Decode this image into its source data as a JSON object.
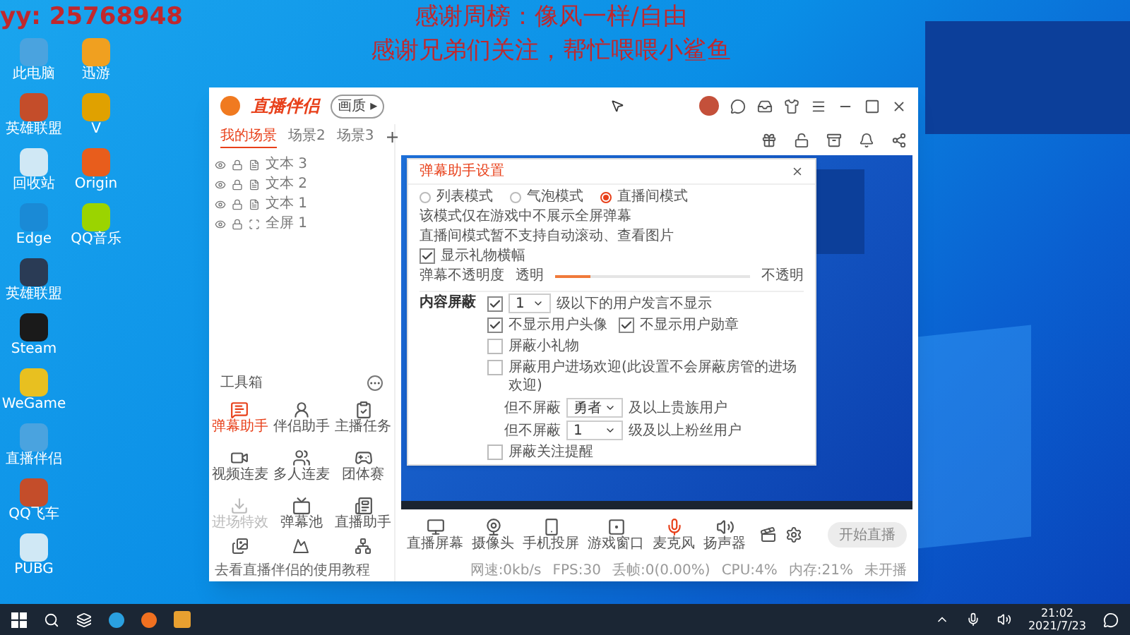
{
  "overlay": {
    "room_text": "yy: 25768948",
    "lines": [
      "感谢周榜：像风一样/自由",
      "感谢兄弟们关注，帮忙喂喂小鲨鱼"
    ]
  },
  "desktop_icons": [
    [
      {
        "label": "此电脑"
      },
      {
        "label": "迅游"
      }
    ],
    [
      {
        "label": "英雄联盟"
      },
      {
        "label": "V"
      }
    ],
    [
      {
        "label": "回收站"
      },
      {
        "label": "Origin"
      }
    ],
    [
      {
        "label": "Edge"
      },
      {
        "label": "QQ音乐"
      }
    ],
    [
      {
        "label": "英雄联盟"
      }
    ],
    [
      {
        "label": "Steam"
      }
    ],
    [
      {
        "label": "WeGame"
      }
    ],
    [
      {
        "label": "直播伴侣"
      }
    ],
    [
      {
        "label": "QQ飞车"
      }
    ],
    [
      {
        "label": "PUBG"
      }
    ]
  ],
  "app": {
    "logo": "直播伴侣",
    "badge": "画质 ▸",
    "scene_tabs": [
      {
        "label": "我的场景",
        "selected": true
      },
      {
        "label": "场景2",
        "selected": false
      },
      {
        "label": "场景3",
        "selected": false
      }
    ],
    "add": "+",
    "sources": [
      {
        "label": "文本 3",
        "kind": "text"
      },
      {
        "label": "文本 2",
        "kind": "text"
      },
      {
        "label": "文本 1",
        "kind": "text"
      },
      {
        "label": "全屏 1",
        "kind": "screen"
      }
    ],
    "toolbox": {
      "title": "工具箱",
      "items": [
        {
          "label": "弹幕助手",
          "selected": true,
          "disabled": false
        },
        {
          "label": "伴侣助手",
          "selected": false,
          "disabled": false
        },
        {
          "label": "主播任务",
          "selected": false,
          "disabled": false
        },
        {
          "label": "视频连麦",
          "selected": false,
          "disabled": false
        },
        {
          "label": "多人连麦",
          "selected": false,
          "disabled": false
        },
        {
          "label": "团体赛",
          "selected": false,
          "disabled": false
        },
        {
          "label": "进场特效",
          "selected": false,
          "disabled": true
        },
        {
          "label": "弹幕池",
          "selected": false,
          "disabled": false
        },
        {
          "label": "直播助手",
          "selected": false,
          "disabled": false
        }
      ]
    },
    "footer_tip": "去看直播伴侣的使用教程",
    "dialog": {
      "title": "弹幕助手设置",
      "modes": [
        {
          "label": "列表模式",
          "selected": false
        },
        {
          "label": "气泡模式",
          "selected": false
        },
        {
          "label": "直播间模式",
          "selected": true
        }
      ],
      "notes": [
        "该模式仅在游戏中不展示全屏弹幕",
        "直播间模式暂不支持自动滚动、查看图片"
      ],
      "gift_banner": {
        "label": "显示礼物横幅",
        "checked": true
      },
      "opacity": {
        "label": "弹幕不透明度",
        "min_label": "透明",
        "max_label": "不透明",
        "level": 0.18
      },
      "filter": {
        "title": "内容屏蔽",
        "level_filter": {
          "checked": true,
          "value": "1",
          "label": "级以下的用户发言不显示"
        },
        "options": [
          {
            "label": "不显示用户头像",
            "checked": true
          },
          {
            "label": "不显示用户勋章",
            "checked": true
          }
        ],
        "block_gifts": {
          "label": "屏蔽小礼物",
          "checked": false
        },
        "block_entry": {
          "label": "屏蔽用户进场欢迎(此设置不会屏蔽房管的进场欢迎)",
          "checked": false
        },
        "exceptions": [
          {
            "prefix": "但不屏蔽",
            "value": "勇者",
            "suffix": "及以上贵族用户"
          },
          {
            "prefix": "但不屏蔽",
            "value": "1",
            "suffix": "级及以上粉丝用户"
          }
        ],
        "block_follow": {
          "label": "屏蔽关注提醒",
          "checked": false
        }
      }
    },
    "controls": [
      {
        "label": "直播屏幕",
        "kind": "plain"
      },
      {
        "label": "摄像头",
        "kind": "plain"
      },
      {
        "label": "手机投屏",
        "kind": "plain"
      },
      {
        "label": "游戏窗口",
        "kind": "plain"
      },
      {
        "label": "麦克风",
        "kind": "mic"
      },
      {
        "label": "扬声器",
        "kind": "plain"
      }
    ],
    "start_button": {
      "label": "开始直播",
      "disabled": true
    },
    "status": [
      "网速:0kb/s",
      "FPS:30",
      "丢帧:0(0.00%)",
      "CPU:4%",
      "内存:21%",
      "未开播"
    ]
  },
  "taskbar": {
    "time": "21:02",
    "date": "2021/7/23"
  }
}
